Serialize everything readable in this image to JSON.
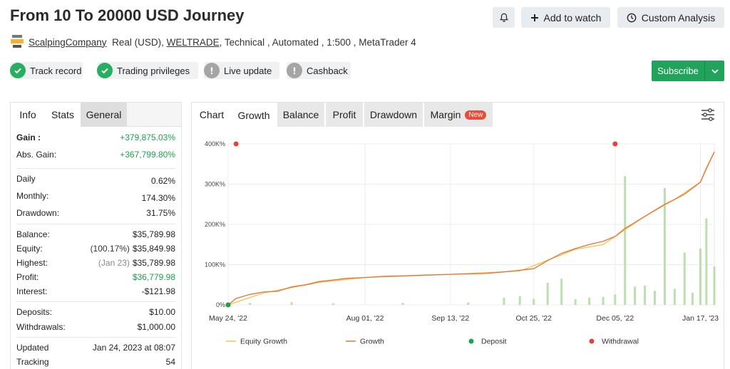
{
  "header": {
    "title": "From 10 To 20000 USD Journey",
    "add_to_watch": "Add to watch",
    "custom_analysis": "Custom Analysis",
    "bell_icon": "bell-icon"
  },
  "meta": {
    "provider": "ScalpingCompany",
    "account": "Real (USD),",
    "broker": "WELTRADE",
    "tags": ", Technical , Automated , 1:500 , MetaTrader 4"
  },
  "badges": [
    {
      "label": "Track record",
      "status": "ok"
    },
    {
      "label": "Trading privileges",
      "status": "ok"
    },
    {
      "label": "Live update",
      "status": "warn"
    },
    {
      "label": "Cashback",
      "status": "warn"
    }
  ],
  "subscribe": {
    "label": "Subscribe"
  },
  "left_tabs": [
    "Info",
    "Stats",
    "General"
  ],
  "stats": {
    "gain": {
      "label": "Gain :",
      "value": "+379,875.03%"
    },
    "abs_gain": {
      "label": "Abs. Gain:",
      "value": "+367,799.80%"
    },
    "daily": {
      "label": "Daily",
      "value": "0.62%"
    },
    "monthly": {
      "label": "Monthly:",
      "value": "174.30%"
    },
    "drawdown": {
      "label": "Drawdown:",
      "value": "31.75%"
    },
    "balance": {
      "label": "Balance:",
      "value": "$35,789.98"
    },
    "equity": {
      "label": "Equity:",
      "pre": "(100.17%)",
      "value": "$35,849.98"
    },
    "highest": {
      "label": "Highest:",
      "pre": "(Jan 23)",
      "value": "$35,789.98"
    },
    "profit": {
      "label": "Profit:",
      "value": "$36,779.98"
    },
    "interest": {
      "label": "Interest:",
      "value": "-$121.98"
    },
    "deposits": {
      "label": "Deposits:",
      "value": "$10.00"
    },
    "withdrawals": {
      "label": "Withdrawals:",
      "value": "$1,000.00"
    },
    "updated": {
      "label": "Updated",
      "value": "Jan 24, 2023 at 08:07"
    },
    "tracking": {
      "label": "Tracking",
      "value": "54"
    }
  },
  "chart_tabs": {
    "chart": "Chart",
    "growth": "Growth",
    "balance": "Balance",
    "profit": "Profit",
    "drawdown": "Drawdown",
    "margin": "Margin",
    "new_badge": "New"
  },
  "colors": {
    "growth": "#e8733a",
    "equity_growth": "#f2c24f",
    "deposit": "#19a34a",
    "withdrawal": "#e8413b",
    "volume": "#b9e0ad",
    "subscribe": "#22a35b"
  },
  "chart_data": {
    "type": "line",
    "x_ticks": [
      "May 24, '22",
      "Aug 01, '22",
      "Sep 13, '22",
      "Oct 25, '22",
      "Dec 05, '22",
      "Jan 17, '23"
    ],
    "y_ticks": [
      "0%",
      "100K%",
      "200K%",
      "300K%",
      "400K%"
    ],
    "ylim": [
      0,
      400000
    ],
    "x_range": [
      "May 24, '22",
      "Jan 24, '23"
    ],
    "grid": true,
    "legend_position": "bottom",
    "legend": [
      "Equity Growth",
      "Growth",
      "Deposit",
      "Withdrawal"
    ],
    "series": [
      {
        "name": "Growth",
        "x": [
          "May 24, '22",
          "May 28, '22",
          "Jun 04, '22",
          "Jun 11, '22",
          "Jun 18, '22",
          "Jun 25, '22",
          "Jul 02, '22",
          "Jul 09, '22",
          "Jul 16, '22",
          "Jul 23, '22",
          "Aug 01, '22",
          "Aug 10, '22",
          "Aug 20, '22",
          "Aug 31, '22",
          "Sep 13, '22",
          "Sep 22, '22",
          "Oct 01, '22",
          "Oct 10, '22",
          "Oct 18, '22",
          "Oct 25, '22",
          "Nov 01, '22",
          "Nov 08, '22",
          "Nov 15, '22",
          "Nov 22, '22",
          "Nov 29, '22",
          "Dec 05, '22",
          "Dec 10, '22",
          "Dec 15, '22",
          "Dec 20, '22",
          "Dec 25, '22",
          "Dec 30, '22",
          "Jan 04, '23",
          "Jan 09, '23",
          "Jan 13, '23",
          "Jan 17, '23",
          "Jan 20, '23",
          "Jan 24, '23"
        ],
        "values": [
          0,
          16000,
          26000,
          32000,
          34000,
          45000,
          50000,
          58000,
          62000,
          66000,
          68000,
          71000,
          72000,
          74000,
          76000,
          77000,
          78000,
          82000,
          86000,
          90000,
          110000,
          128000,
          140000,
          150000,
          158000,
          170000,
          190000,
          205000,
          220000,
          235000,
          250000,
          262000,
          275000,
          290000,
          305000,
          340000,
          380000
        ]
      },
      {
        "name": "Equity Growth",
        "x": [
          "May 24, '22",
          "Jun 11, '22",
          "Jul 09, '22",
          "Aug 01, '22",
          "Sep 13, '22",
          "Oct 18, '22",
          "Nov 15, '22",
          "Nov 29, '22",
          "Dec 05, '22",
          "Dec 20, '22",
          "Jan 04, '23",
          "Jan 17, '23",
          "Jan 24, '23"
        ],
        "values": [
          0,
          30000,
          56000,
          68000,
          76000,
          84000,
          138000,
          150000,
          170000,
          220000,
          262000,
          305000,
          380000
        ]
      }
    ],
    "points": [
      {
        "name": "Deposit",
        "x": "May 24, '22",
        "y": 0
      },
      {
        "name": "Withdrawal",
        "x": "May 28, '22",
        "y": 400000
      },
      {
        "name": "Withdrawal",
        "x": "Dec 05, '22",
        "y": 400000
      }
    ],
    "bars": [
      {
        "x": "Jun 04, '22",
        "value": 5000
      },
      {
        "x": "Jun 25, '22",
        "value": 7000
      },
      {
        "x": "Jul 16, '22",
        "value": 4000
      },
      {
        "x": "Aug 20, '22",
        "value": 5000
      },
      {
        "x": "Sep 22, '22",
        "value": 6000
      },
      {
        "x": "Oct 10, '22",
        "value": 18000
      },
      {
        "x": "Oct 18, '22",
        "value": 22000
      },
      {
        "x": "Oct 25, '22",
        "value": 15000
      },
      {
        "x": "Nov 01, '22",
        "value": 55000
      },
      {
        "x": "Nov 08, '22",
        "value": 65000
      },
      {
        "x": "Nov 15, '22",
        "value": 14000
      },
      {
        "x": "Nov 22, '22",
        "value": 18000
      },
      {
        "x": "Nov 29, '22",
        "value": 20000
      },
      {
        "x": "Dec 05, '22",
        "value": 26000
      },
      {
        "x": "Dec 10, '22",
        "value": 320000
      },
      {
        "x": "Dec 15, '22",
        "value": 45000
      },
      {
        "x": "Dec 20, '22",
        "value": 48000
      },
      {
        "x": "Dec 25, '22",
        "value": 35000
      },
      {
        "x": "Dec 30, '22",
        "value": 290000
      },
      {
        "x": "Jan 04, '23",
        "value": 40000
      },
      {
        "x": "Jan 09, '23",
        "value": 130000
      },
      {
        "x": "Jan 13, '23",
        "value": 30000
      },
      {
        "x": "Jan 17, '23",
        "value": 140000
      },
      {
        "x": "Jan 20, '23",
        "value": 215000
      },
      {
        "x": "Jan 24, '23",
        "value": 95000
      }
    ]
  }
}
